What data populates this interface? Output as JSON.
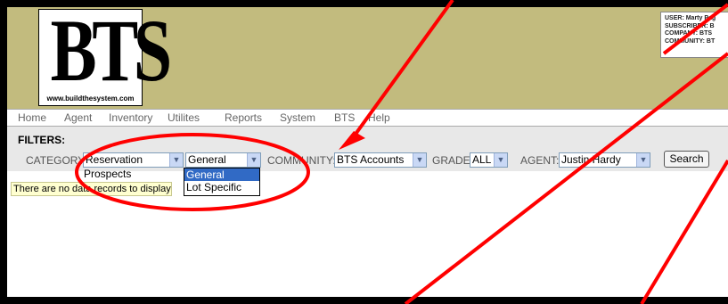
{
  "logo": {
    "letters": "BTS",
    "url": "www.buildthesystem.com"
  },
  "user_info": {
    "user": "USER: Marty Pag",
    "subscriber": "SUBSCRIBER: B",
    "company": "COMPANY: BTS",
    "community": "COMMUNITY: BT"
  },
  "menu": {
    "home": "Home",
    "agent": "Agent",
    "inventory": "Inventory",
    "utilities": "Utilites",
    "reports": "Reports",
    "system": "System",
    "bts": "BTS",
    "help": "Help"
  },
  "filters": {
    "heading": "FILTERS:",
    "category_label": "CATEGORY:",
    "category_value": "Reservation",
    "type_value": "General",
    "community_label": "COMMUNITY:",
    "community_value": "BTS Accounts",
    "grade_label": "GRADE:",
    "grade_value": "ALL",
    "agent_label": "AGENT:",
    "agent_value": "Justin Hardy",
    "search_button": "Search"
  },
  "category_dropdown": {
    "items": [
      "Prospects"
    ]
  },
  "type_dropdown": {
    "items": [
      "General",
      "Lot Specific"
    ],
    "selected": "General"
  },
  "message": "There are no data records to display",
  "colors": {
    "header": "#c2bb7e",
    "annotation": "#ff0000",
    "highlight": "#316ac5"
  }
}
